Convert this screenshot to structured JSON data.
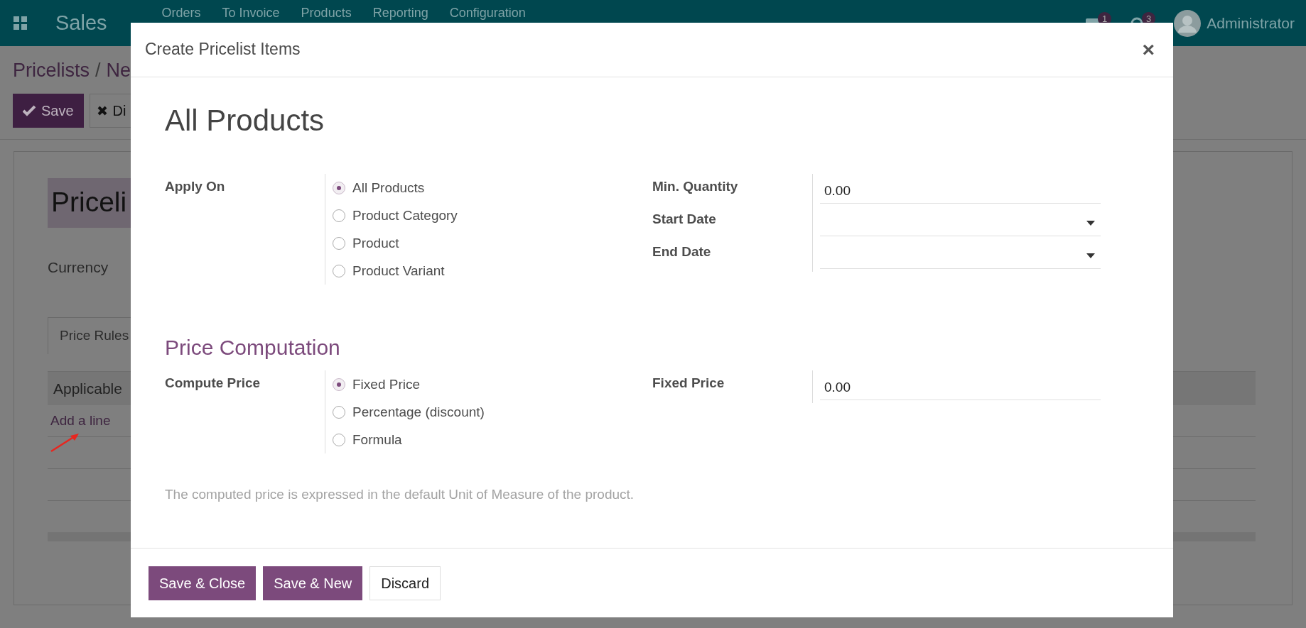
{
  "navbar": {
    "app_name": "Sales",
    "menu": [
      "Orders",
      "To Invoice",
      "Products",
      "Reporting",
      "Configuration"
    ],
    "notifications": [
      {
        "kind": "chat",
        "count": "1"
      },
      {
        "kind": "activity",
        "count": "3"
      }
    ],
    "user": "Administrator"
  },
  "breadcrumb": {
    "items": [
      "Pricelists",
      "Ne"
    ],
    "separator": "/"
  },
  "actions": [
    {
      "label": "Save",
      "kind": "primary"
    },
    {
      "label": "Di",
      "kind": "secondary"
    }
  ],
  "sheet": {
    "title": "Priceli",
    "fields": [
      {
        "label": "Currency"
      }
    ],
    "tabs": [
      {
        "label": "Price Rules",
        "selected": true
      }
    ],
    "table": {
      "columns": [
        "Applicable"
      ],
      "add_line": "Add a line"
    }
  },
  "dialog": {
    "title": "Create Pricelist Items",
    "close": "×",
    "heading": "All Products",
    "apply_on": {
      "label": "Apply On",
      "options": [
        {
          "label": "All Products",
          "selected": true
        },
        {
          "label": "Product Category",
          "selected": false
        },
        {
          "label": "Product",
          "selected": false
        },
        {
          "label": "Product Variant",
          "selected": false
        }
      ]
    },
    "fields": [
      {
        "label": "Min. Quantity",
        "kind": "text",
        "value": "0.00"
      },
      {
        "label": "Start Date",
        "kind": "date"
      },
      {
        "label": "End Date",
        "kind": "date"
      }
    ],
    "section_title": "Price Computation",
    "compute": {
      "label": "Compute Price",
      "options": [
        {
          "label": "Fixed Price",
          "selected": true
        },
        {
          "label": "Percentage (discount)",
          "selected": false
        },
        {
          "label": "Formula",
          "selected": false
        }
      ]
    },
    "price_fields": [
      {
        "label": "Fixed Price",
        "kind": "text",
        "value": "0.00"
      }
    ],
    "note": "The computed price is expressed in the default Unit of Measure of the product.",
    "buttons": [
      {
        "label": "Save & Close",
        "kind": "primary"
      },
      {
        "label": "Save & New",
        "kind": "primary"
      },
      {
        "label": "Discard",
        "kind": "secondary"
      }
    ]
  }
}
